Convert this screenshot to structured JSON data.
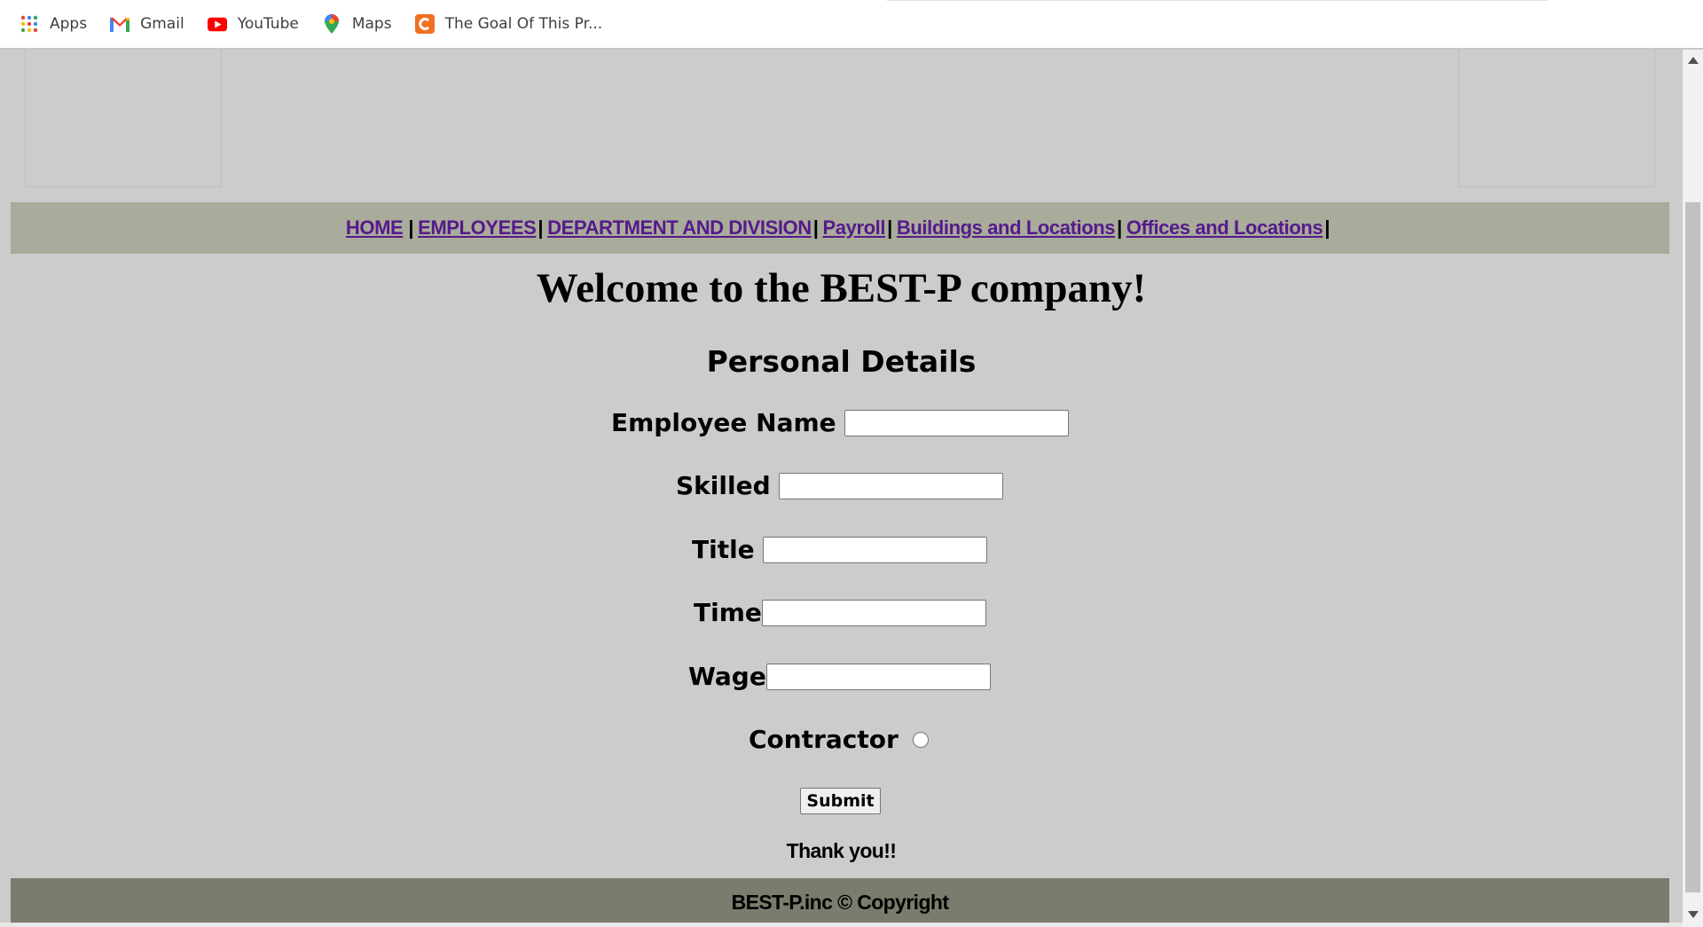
{
  "bookmarks": [
    {
      "label": "Apps",
      "icon": "apps-grid-icon"
    },
    {
      "label": "Gmail",
      "icon": "gmail-icon"
    },
    {
      "label": "YouTube",
      "icon": "youtube-icon"
    },
    {
      "label": "Maps",
      "icon": "maps-pin-icon"
    },
    {
      "label": "The Goal Of This Pr...",
      "icon": "c-logo-icon"
    }
  ],
  "nav": {
    "links": [
      "HOME",
      "EMPLOYEES",
      "DEPARTMENT AND DIVISION",
      "Payroll",
      "Buildings and Locations",
      "Offices and Locations"
    ],
    "separator": "|"
  },
  "main": {
    "welcome": "Welcome to the BEST-P company!",
    "section_title": "Personal Details",
    "fields": {
      "employee_name": {
        "label": "Employee Name",
        "value": ""
      },
      "skilled": {
        "label": "Skilled",
        "value": ""
      },
      "title": {
        "label": "Title",
        "value": ""
      },
      "time": {
        "label": "Time",
        "value": ""
      },
      "wage": {
        "label": "Wage",
        "value": ""
      },
      "contractor": {
        "label": "Contractor"
      }
    },
    "submit_label": "Submit",
    "thanks": "Thank you!!"
  },
  "footer": {
    "text": "BEST-P.inc © Copyright"
  },
  "colors": {
    "nav_bg": "#a9ab9b",
    "footer_bg": "#7a7c6e",
    "page_bg": "#cccccc",
    "link": "#551a8b"
  }
}
